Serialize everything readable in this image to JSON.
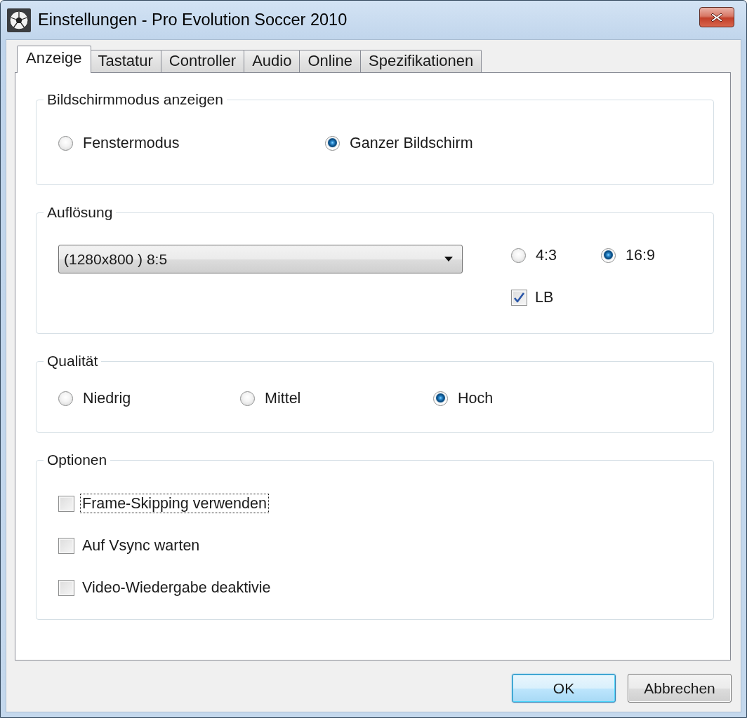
{
  "window": {
    "title": "Einstellungen - Pro Evolution Soccer 2010"
  },
  "tabs": [
    {
      "label": "Anzeige",
      "selected": true
    },
    {
      "label": "Tastatur",
      "selected": false
    },
    {
      "label": "Controller",
      "selected": false
    },
    {
      "label": "Audio",
      "selected": false
    },
    {
      "label": "Online",
      "selected": false
    },
    {
      "label": "Spezifikationen",
      "selected": false
    }
  ],
  "groups": [
    {
      "kind": "radio-row",
      "title": "Bildschirmmodus anzeigen",
      "items": [
        {
          "label": "Fenstermodus",
          "selected": false
        },
        {
          "label": "Ganzer Bildschirm",
          "selected": true
        }
      ]
    },
    {
      "kind": "resolution",
      "title": "Auflösung",
      "dropdown": {
        "value": "(1280x800 ) 8:5"
      },
      "aspect": [
        {
          "label": "4:3",
          "selected": false
        },
        {
          "label": "16:9",
          "selected": true
        }
      ],
      "letterbox": {
        "label": "LB",
        "checked": true
      }
    },
    {
      "kind": "radio-row",
      "title": "Qualität",
      "items": [
        {
          "label": "Niedrig",
          "selected": false
        },
        {
          "label": "Mittel",
          "selected": false
        },
        {
          "label": "Hoch",
          "selected": true
        }
      ]
    },
    {
      "kind": "checkbox-list",
      "title": "Optionen",
      "items": [
        {
          "label": "Frame-Skipping verwenden",
          "checked": false,
          "focused": true
        },
        {
          "label": "Auf Vsync warten",
          "checked": false,
          "focused": false
        },
        {
          "label": "Video-Wiedergabe deaktivie",
          "checked": false,
          "focused": false
        }
      ]
    }
  ],
  "buttons": [
    {
      "label": "OK",
      "default": true
    },
    {
      "label": "Abbrechen",
      "default": false
    }
  ]
}
